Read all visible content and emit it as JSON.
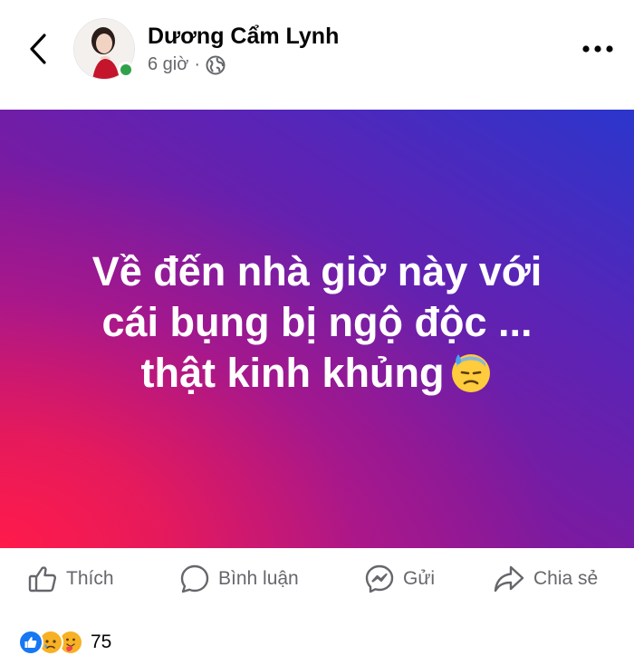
{
  "header": {
    "author_name": "Dương Cẩm Lynh",
    "time_ago": "6 giờ",
    "separator": "·",
    "privacy_icon": "globe-icon",
    "back_icon": "chevron-left-icon",
    "more_icon": "more-horizontal-icon"
  },
  "post": {
    "text": "Về đến nhà giờ này với\ncái bụng bị ngộ độc ...\nthật  kinh khủng",
    "emoji": "downcast-face-with-sweat-emoji",
    "background": {
      "primary": "#6a22a8",
      "accent_red": "#ff1a4a",
      "accent_blue": "#2b36cc"
    }
  },
  "actions": [
    {
      "label": "Thích",
      "icon": "thumbs-up-icon"
    },
    {
      "label": "Bình luận",
      "icon": "comment-bubble-icon"
    },
    {
      "label": "Gửi",
      "icon": "messenger-icon"
    },
    {
      "label": "Chia sẻ",
      "icon": "share-arrow-icon"
    }
  ],
  "reactions": {
    "icons": [
      "like-reaction-icon",
      "sad-reaction-icon",
      "care-reaction-icon"
    ],
    "count": "75"
  },
  "colors": {
    "online": "#31a24c",
    "like_blue": "#1877f2",
    "reaction_yellow": "#f7b125",
    "secondary_text": "#65676b"
  }
}
